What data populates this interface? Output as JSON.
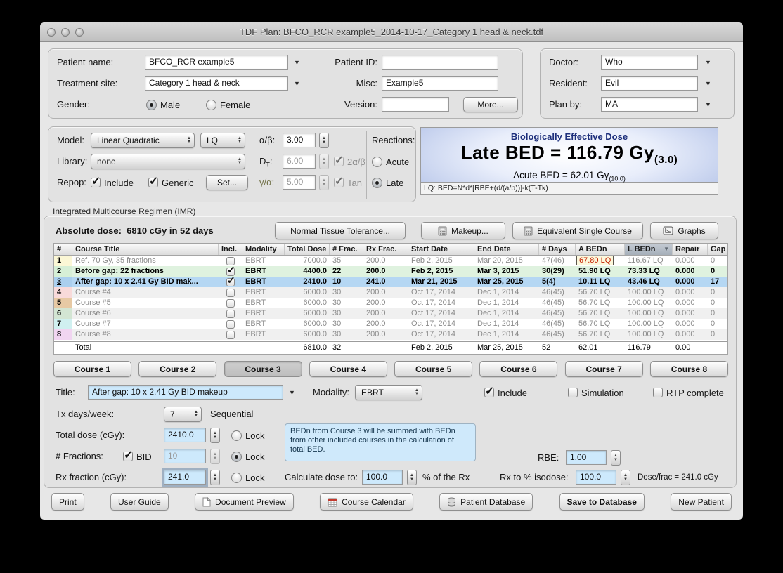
{
  "window": {
    "title": "TDF Plan: BFCO_RCR example5_2014-10-17_Category 1 head & neck.tdf"
  },
  "patient": {
    "name_label": "Patient name:",
    "name": "BFCO_RCR example5",
    "site_label": "Treatment site:",
    "site": "Category 1 head & neck",
    "gender_label": "Gender:",
    "male": "Male",
    "female": "Female",
    "id_label": "Patient ID:",
    "id": "",
    "misc_label": "Misc:",
    "misc": "Example5",
    "version_label": "Version:",
    "version": "",
    "more_button": "More...",
    "doctor_label": "Doctor:",
    "doctor": "Who",
    "resident_label": "Resident:",
    "resident": "Evil",
    "planby_label": "Plan by:",
    "planby": "MA"
  },
  "model": {
    "model_label": "Model:",
    "model_value": "Linear Quadratic",
    "model_short": "LQ",
    "library_label": "Library:",
    "library_value": "none",
    "repop_label": "Repop:",
    "include_label": "Include",
    "generic_label": "Generic",
    "set_button": "Set...",
    "ab_label": "α/β:",
    "ab_value": "3.00",
    "dt_main": "D",
    "dt_sub": "T",
    "dt_colon": ":",
    "dt_value": "6.00",
    "dt_check": "2α/β",
    "ga_label": "γ/α:",
    "ga_value": "5.00",
    "ga_check": "Tan",
    "reactions_label": "Reactions:",
    "acute": "Acute",
    "late": "Late"
  },
  "bed": {
    "title": "Biologically Effective Dose",
    "late_prefix": "Late BED = 116.79 Gy",
    "late_sub": "(3.0)",
    "acute_prefix": "Acute BED = 62.01 Gy",
    "acute_sub": "(10.0)",
    "formula": "LQ: BED=N*d*[RBE+(d/(a/b))]-k(T-Tk)"
  },
  "imr": {
    "section_label": "Integrated Multicourse Regimen (IMR)",
    "absolute_dose_label": "Absolute dose:",
    "absolute_dose_value": "6810 cGy in 52 days",
    "buttons": {
      "ntt": "Normal Tissue Tolerance...",
      "makeup": "Makeup...",
      "esc": "Equivalent Single Course",
      "graphs": "Graphs"
    },
    "table": {
      "headers": [
        "#",
        "Course Title",
        "Incl.",
        "Modality",
        "Total Dose",
        "# Frac.",
        "Rx Frac.",
        "Start Date",
        "End Date",
        "# Days",
        "A BEDn",
        "L BEDn",
        "Repair",
        "Gap"
      ],
      "rows": [
        {
          "num": "1",
          "num_color": "#fbf7d5",
          "title": "Ref. 70 Gy, 35 fractions",
          "incl": false,
          "modality": "EBRT",
          "total_dose": "7000.0",
          "num_frac": "35",
          "rx_frac": "200.0",
          "start_date": "Feb 2, 2015",
          "end_date": "Mar 20, 2015",
          "num_days": "47(46)",
          "a_bedn": "67.80 LQ",
          "l_bedn": "116.67 LQ",
          "repair": "0.000",
          "gap": "0",
          "state": "dim",
          "stripe": false,
          "a_alert": true,
          "num_underline": false
        },
        {
          "num": "2",
          "num_color": "#d6efd6",
          "title": "Before gap: 22 fractions",
          "incl": true,
          "modality": "EBRT",
          "total_dose": "4400.0",
          "num_frac": "22",
          "rx_frac": "200.0",
          "start_date": "Feb 2, 2015",
          "end_date": "Mar 3, 2015",
          "num_days": "30(29)",
          "a_bedn": "51.90 LQ",
          "l_bedn": "73.33 LQ",
          "repair": "0.000",
          "gap": "0",
          "state": "green",
          "stripe": false,
          "a_alert": false,
          "num_underline": false
        },
        {
          "num": "3",
          "num_color": "#aacfee",
          "title": "After gap: 10 x 2.41 Gy BID mak...",
          "incl": true,
          "modality": "EBRT",
          "total_dose": "2410.0",
          "num_frac": "10",
          "rx_frac": "241.0",
          "start_date": "Mar 21, 2015",
          "end_date": "Mar 25, 2015",
          "num_days": "5(4)",
          "a_bedn": "10.11 LQ",
          "l_bedn": "43.46 LQ",
          "repair": "0.000",
          "gap": "17",
          "state": "selected",
          "stripe": false,
          "a_alert": false,
          "num_underline": true
        },
        {
          "num": "4",
          "num_color": "#f8dada",
          "title": "Course #4",
          "incl": false,
          "modality": "EBRT",
          "total_dose": "6000.0",
          "num_frac": "30",
          "rx_frac": "200.0",
          "start_date": "Oct 17, 2014",
          "end_date": "Dec 1, 2014",
          "num_days": "46(45)",
          "a_bedn": "56.70 LQ",
          "l_bedn": "100.00 LQ",
          "repair": "0.000",
          "gap": "0",
          "state": "dim",
          "stripe": true,
          "a_alert": false,
          "num_underline": false
        },
        {
          "num": "5",
          "num_color": "#e7c9a4",
          "title": "Course #5",
          "incl": false,
          "modality": "EBRT",
          "total_dose": "6000.0",
          "num_frac": "30",
          "rx_frac": "200.0",
          "start_date": "Oct 17, 2014",
          "end_date": "Dec 1, 2014",
          "num_days": "46(45)",
          "a_bedn": "56.70 LQ",
          "l_bedn": "100.00 LQ",
          "repair": "0.000",
          "gap": "0",
          "state": "dim",
          "stripe": false,
          "a_alert": false,
          "num_underline": false
        },
        {
          "num": "6",
          "num_color": "#d3e5d3",
          "title": "Course #6",
          "incl": false,
          "modality": "EBRT",
          "total_dose": "6000.0",
          "num_frac": "30",
          "rx_frac": "200.0",
          "start_date": "Oct 17, 2014",
          "end_date": "Dec 1, 2014",
          "num_days": "46(45)",
          "a_bedn": "56.70 LQ",
          "l_bedn": "100.00 LQ",
          "repair": "0.000",
          "gap": "0",
          "state": "dim",
          "stripe": true,
          "a_alert": false,
          "num_underline": false
        },
        {
          "num": "7",
          "num_color": "#d0f0f0",
          "title": "Course #7",
          "incl": false,
          "modality": "EBRT",
          "total_dose": "6000.0",
          "num_frac": "30",
          "rx_frac": "200.0",
          "start_date": "Oct 17, 2014",
          "end_date": "Dec 1, 2014",
          "num_days": "46(45)",
          "a_bedn": "56.70 LQ",
          "l_bedn": "100.00 LQ",
          "repair": "0.000",
          "gap": "0",
          "state": "dim",
          "stripe": false,
          "a_alert": false,
          "num_underline": false
        },
        {
          "num": "8",
          "num_color": "#f1d5f1",
          "title": "Course #8",
          "incl": false,
          "modality": "EBRT",
          "total_dose": "6000.0",
          "num_frac": "30",
          "rx_frac": "200.0",
          "start_date": "Oct 17, 2014",
          "end_date": "Dec 1, 2014",
          "num_days": "46(45)",
          "a_bedn": "56.70 LQ",
          "l_bedn": "100.00 LQ",
          "repair": "0.000",
          "gap": "0",
          "state": "dim",
          "stripe": true,
          "a_alert": false,
          "num_underline": false
        }
      ],
      "total": {
        "label": "Total",
        "total_dose": "6810.0",
        "num_frac": "32",
        "start_date": "Feb 2, 2015",
        "end_date": "Mar 25, 2015",
        "num_days": "52",
        "a_bedn": "62.01",
        "l_bedn": "116.79",
        "repair": "0.00"
      }
    },
    "course_buttons": [
      "Course 1",
      "Course 2",
      "Course 3",
      "Course 4",
      "Course 5",
      "Course 6",
      "Course 7",
      "Course 8"
    ],
    "active_course_index": 2
  },
  "course": {
    "title_label": "Title:",
    "title_value": "After gap: 10 x 2.41 Gy BID makeup",
    "modality_label": "Modality:",
    "modality_value": "EBRT",
    "include_label": "Include",
    "simulation_label": "Simulation",
    "rtp_label": "RTP complete",
    "txdays_label": "Tx days/week:",
    "txdays_value": "7",
    "sequential_label": "Sequential",
    "totaldose_label": "Total dose (cGy):",
    "totaldose_value": "2410.0",
    "fractions_label": "# Fractions:",
    "bid_label": "BID",
    "fractions_value": "10",
    "rxfraction_label": "Rx fraction (cGy):",
    "rxfraction_value": "241.0",
    "lock_label": "Lock",
    "info_text": "BEDn from Course 3 will be summed with BEDn from other included courses in the calculation of total BED.",
    "rbe_label": "RBE:",
    "rbe_value": "1.00",
    "calcdose_label": "Calculate dose to:",
    "calcdose_value": "100.0",
    "calcdose_suffix": "% of the Rx",
    "isodose_label": "Rx to % isodose:",
    "isodose_value": "100.0",
    "dosefrac_note": "Dose/frac = 241.0 cGy"
  },
  "footer": {
    "print": "Print",
    "user_guide": "User Guide",
    "doc_preview": "Document Preview",
    "course_calendar": "Course Calendar",
    "patient_db": "Patient Database",
    "save_db": "Save to Database",
    "new_patient": "New Patient"
  },
  "colors": {
    "selected_row": "#b5d7f3",
    "included_row": "#dff2df",
    "alert_text": "#c41f00",
    "alert_bg": "#fdf8dc",
    "blue_field": "#cde9fc",
    "bed_panel_edge": "#9db1dd"
  }
}
